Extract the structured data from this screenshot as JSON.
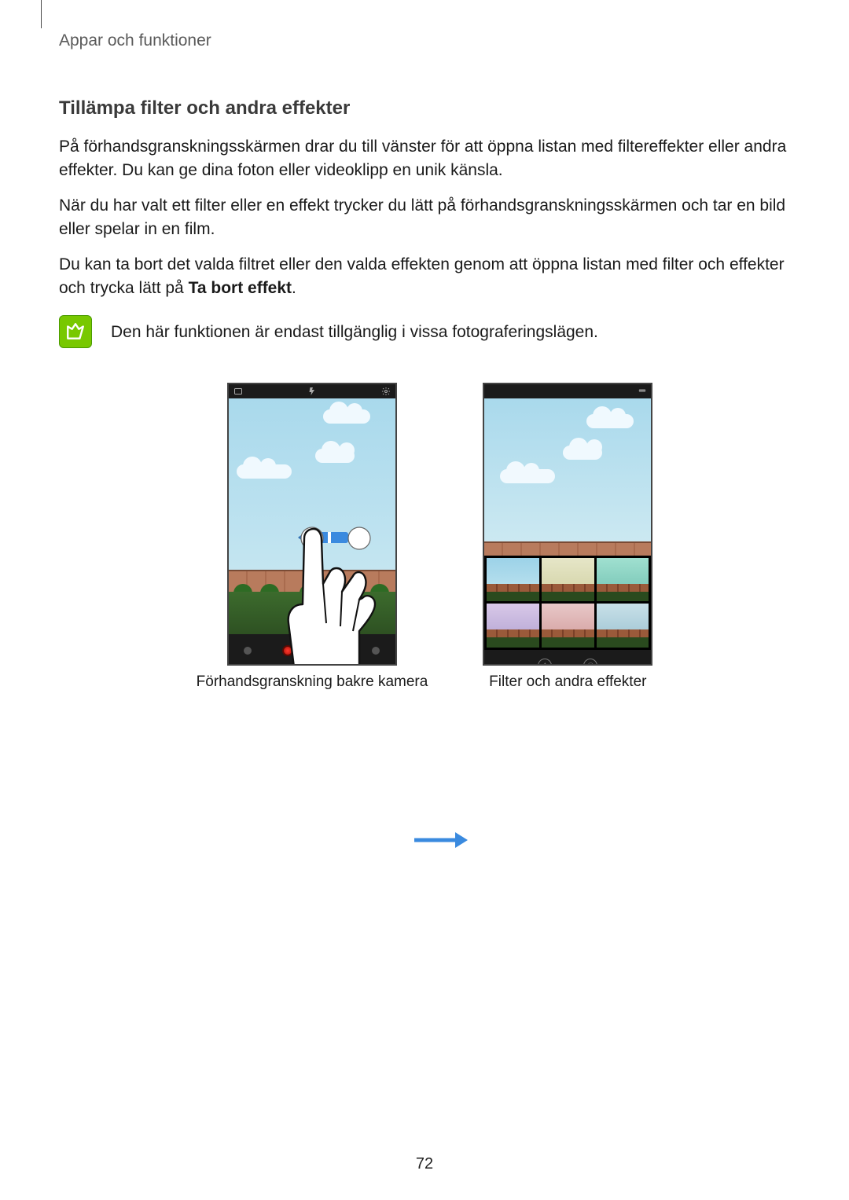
{
  "breadcrumb": "Appar och funktioner",
  "section_title": "Tillämpa filter och andra effekter",
  "paragraphs": {
    "p1": "På förhandsgranskningsskärmen drar du till vänster för att öppna listan med filtereffekter eller andra effekter. Du kan ge dina foton eller videoklipp en unik känsla.",
    "p2": "När du har valt ett filter eller en effekt trycker du lätt på förhandsgranskningsskärmen och tar en bild eller spelar in en film.",
    "p3_before": "Du kan ta bort det valda filtret eller den valda effekten genom att öppna listan med filter och effekter och trycka lätt på ",
    "p3_bold": "Ta bort effekt",
    "p3_after": "."
  },
  "note": "Den här funktionen är endast tillgänglig i vissa fotograferingslägen.",
  "captions": {
    "left": "Förhandsgranskning bakre kamera",
    "right": "Filter och andra effekter"
  },
  "page_number": "72"
}
